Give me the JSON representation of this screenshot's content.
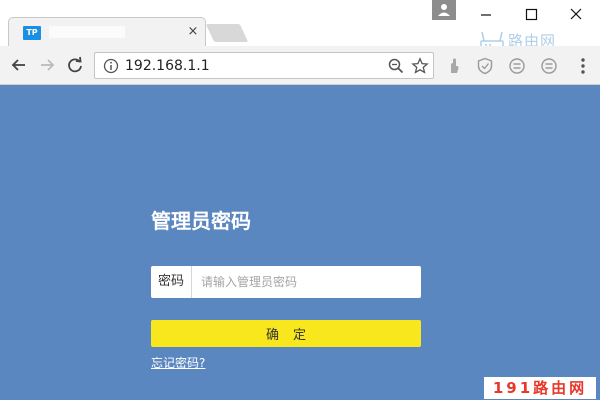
{
  "tab": {
    "favicon_text": "TP",
    "close_glyph": "×"
  },
  "address_bar": {
    "url": "192.168.1.1"
  },
  "login": {
    "title": "管理员密码",
    "password_label": "密码",
    "password_placeholder": "请输入管理员密码",
    "password_value": "",
    "confirm_label": "确定",
    "forgot_link": "忘记密码?"
  },
  "watermarks": {
    "top_right": "路由网",
    "bottom_right": "191路由网"
  },
  "colors": {
    "page_background": "#5b87c0",
    "confirm_button": "#f8e71c",
    "favicon": "#1a8fe3",
    "watermark_red": "#e8382b"
  },
  "icons": {
    "back": "arrow-left-icon",
    "forward": "arrow-right-icon",
    "reload": "reload-icon",
    "info": "info-icon",
    "zoom": "zoom-icon",
    "bookmark": "star-icon",
    "menu": "kebab-menu-icon"
  }
}
